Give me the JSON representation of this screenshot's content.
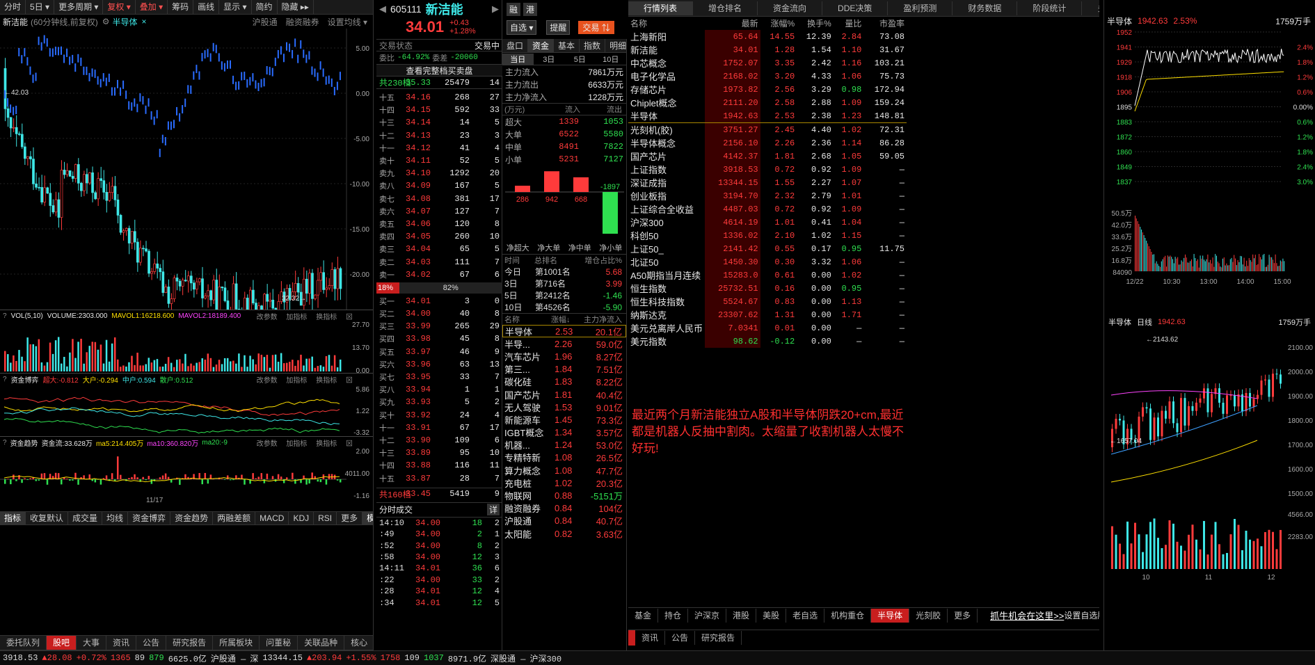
{
  "left": {
    "toolbar": [
      "分时",
      "5日 ▾",
      "更多周期 ▾",
      "复权 ▾",
      "叠加 ▾",
      "筹码",
      "画线",
      "显示 ▾",
      "简约",
      "隐藏 ▸▸"
    ],
    "title": "新洁能",
    "title_sub": "(60分钟线,前复权)",
    "overlay": "半导体",
    "top_links": [
      "沪股通",
      "融资融券",
      "设置均线 ▾"
    ],
    "axis": [
      "5.00",
      "0.00",
      "-5.00",
      "-10.00",
      "-15.00",
      "-20.00"
    ],
    "hi": "42.03",
    "lo": "32.32",
    "vol": {
      "label": "VOL(5,10)",
      "v1": "VOLUME:2303.000",
      "v2": "MAVOL1:16218.600",
      "v3": "MAVOL2:18189.400",
      "axis": [
        "27.70",
        "13.70",
        "0.00"
      ]
    },
    "zjbk": {
      "label": "资金博弈",
      "big": "超大:-0.812",
      "dh": "大户:-0.294",
      "zh": "中户:0.594",
      "sh": "散户:0.512",
      "axis": [
        "5.86",
        "1.22",
        "-3.32"
      ]
    },
    "zjqs": {
      "label": "资金趋势",
      "flow": "资金流:33.628万",
      "ma5": "ma5:214.405万",
      "ma10": "ma10:360.820万",
      "ma20": "ma20:-9",
      "axis": [
        "2.00",
        "4011.00",
        "-1.16"
      ]
    },
    "tools": [
      "改参数",
      "加指标",
      "换指标"
    ],
    "date": "11/17",
    "ind_tabs": [
      "指标",
      "收复默认",
      "成交量",
      "均线",
      "资金博弈",
      "资金趋势",
      "两融差额",
      "MACD",
      "KDJ",
      "RSI",
      "更多",
      "模板"
    ],
    "bot_tabs": [
      "委托队列",
      "股吧",
      "大事",
      "资讯",
      "公告",
      "研究报告",
      "所属板块",
      "问董秘",
      "关联品种",
      "核心"
    ]
  },
  "quote": {
    "code": "605111",
    "name": "新洁能",
    "price": "34.01",
    "chg": "+0.43",
    "pct": "+1.28%",
    "btn1": "融",
    "btn2": "港",
    "self": "自选 ▾",
    "remind": "提醒",
    "trade": "交易 ⇅",
    "status": "交易状态",
    "status_v": "交易中",
    "wb": "委比",
    "wb_v": "-64.92%",
    "wc": "委差",
    "wc_v": "-20060",
    "all": "查看完整档买卖盘",
    "total_ask": "共230档",
    "total_ask_p": "35.33",
    "total_ask_v": "25479",
    "total_ask_n": "14",
    "asks": [
      [
        "十五",
        "34.16",
        "268",
        "27"
      ],
      [
        "十四",
        "34.15",
        "592",
        "33"
      ],
      [
        "十三",
        "34.14",
        "14",
        "5"
      ],
      [
        "十二",
        "34.13",
        "23",
        "3"
      ],
      [
        "十一",
        "34.12",
        "41",
        "4"
      ],
      [
        "卖十",
        "34.11",
        "52",
        "5"
      ],
      [
        "卖九",
        "34.10",
        "1292",
        "20"
      ],
      [
        "卖八",
        "34.09",
        "167",
        "5"
      ],
      [
        "卖七",
        "34.08",
        "381",
        "17"
      ],
      [
        "卖六",
        "34.07",
        "127",
        "7"
      ],
      [
        "卖五",
        "34.06",
        "120",
        "8"
      ],
      [
        "卖四",
        "34.05",
        "260",
        "10"
      ],
      [
        "卖三",
        "34.04",
        "65",
        "5"
      ],
      [
        "卖二",
        "34.03",
        "111",
        "7"
      ],
      [
        "卖一",
        "34.02",
        "67",
        "6"
      ]
    ],
    "ratio_l": "18%",
    "ratio_r": "82%",
    "bids": [
      [
        "买一",
        "34.01",
        "3",
        "0"
      ],
      [
        "买二",
        "34.00",
        "40",
        "8"
      ],
      [
        "买三",
        "33.99",
        "265",
        "29"
      ],
      [
        "买四",
        "33.98",
        "45",
        "8"
      ],
      [
        "买五",
        "33.97",
        "46",
        "9"
      ],
      [
        "买六",
        "33.96",
        "63",
        "13"
      ],
      [
        "买七",
        "33.95",
        "33",
        "7"
      ],
      [
        "买八",
        "33.94",
        "1",
        "1"
      ],
      [
        "买九",
        "33.93",
        "5",
        "2"
      ],
      [
        "买十",
        "33.92",
        "24",
        "4"
      ],
      [
        "十一",
        "33.91",
        "67",
        "17"
      ],
      [
        "十二",
        "33.90",
        "109",
        "6"
      ],
      [
        "十三",
        "33.89",
        "95",
        "10"
      ],
      [
        "十四",
        "33.88",
        "116",
        "11"
      ],
      [
        "十五",
        "33.87",
        "28",
        "7"
      ]
    ],
    "total_bid": "共160档",
    "total_bid_p": "33.45",
    "total_bid_v": "5419",
    "total_bid_n": "9",
    "ticks_title": "分时成交",
    "ticks_more": "详",
    "ticks": [
      [
        "14:10",
        "34.00",
        "18",
        "2"
      ],
      [
        ":49",
        "34.00",
        "2",
        "1"
      ],
      [
        ":52",
        "34.00",
        "8",
        "2"
      ],
      [
        ":58",
        "34.00",
        "12",
        "3"
      ],
      [
        "14:11",
        "34.01",
        "36",
        "6"
      ],
      [
        ":22",
        "34.00",
        "33",
        "2"
      ],
      [
        ":28",
        "34.01",
        "12",
        "4"
      ],
      [
        ":34",
        "34.01",
        "12",
        "5"
      ]
    ]
  },
  "fund": {
    "tabs": [
      "盘口",
      "资金",
      "基本",
      "指数",
      "明细",
      "逐笔"
    ],
    "days": [
      "当日",
      "3日",
      "5日",
      "10日"
    ],
    "flows": [
      [
        "主力流入",
        "7861万元"
      ],
      [
        "主力流出",
        "6633万元"
      ],
      [
        "主力净流入",
        "1228万元"
      ]
    ],
    "hdr": [
      "(万元)",
      "流入",
      "流出"
    ],
    "rows": [
      [
        "超大",
        "1339",
        "1053"
      ],
      [
        "大单",
        "6522",
        "5580"
      ],
      [
        "中单",
        "8491",
        "7822"
      ],
      [
        "小单",
        "5231",
        "7127"
      ]
    ],
    "bars": [
      {
        "v": 286,
        "l": "286"
      },
      {
        "v": 942,
        "l": "942"
      },
      {
        "v": 668,
        "l": "668"
      },
      {
        "v": -1897,
        "l": "-1897"
      }
    ],
    "bar_lbls": [
      "净超大",
      "净大单",
      "净中单",
      "净小单"
    ],
    "rank_hdr": [
      "时间",
      "总排名",
      "增仓占比%"
    ],
    "ranks": [
      [
        "今日",
        "第1001名",
        "5.68"
      ],
      [
        "3日",
        "第716名",
        "3.99"
      ],
      [
        "5日",
        "第2412名",
        "-1.46"
      ],
      [
        "10日",
        "第4526名",
        "-5.90"
      ]
    ],
    "sect_hdr": [
      "名称",
      "涨幅↓",
      "主力净流入"
    ],
    "sects": [
      [
        "半导体",
        "2.53",
        "20.1亿"
      ],
      [
        "半导...",
        "2.26",
        "59.0亿"
      ],
      [
        "汽车芯片",
        "1.96",
        "8.27亿"
      ],
      [
        "第三...",
        "1.84",
        "7.51亿"
      ],
      [
        "碳化硅",
        "1.83",
        "8.22亿"
      ],
      [
        "国产芯片",
        "1.81",
        "40.4亿"
      ],
      [
        "无人驾驶",
        "1.53",
        "9.01亿"
      ],
      [
        "新能源车",
        "1.45",
        "73.3亿"
      ],
      [
        "IGBT概念",
        "1.34",
        "3.57亿"
      ],
      [
        "机器...",
        "1.24",
        "53.0亿"
      ],
      [
        "专精特新",
        "1.08",
        "26.5亿"
      ],
      [
        "算力概念",
        "1.08",
        "47.7亿"
      ],
      [
        "充电桩",
        "1.02",
        "20.3亿"
      ],
      [
        "物联网",
        "0.88",
        "-5151万"
      ],
      [
        "融资融券",
        "0.84",
        "104亿"
      ],
      [
        "沪股通",
        "0.84",
        "40.7亿"
      ],
      [
        "太阳能",
        "0.82",
        "3.63亿"
      ]
    ]
  },
  "mkt": {
    "tabs": [
      "行情列表",
      "增仓排名",
      "资金流向",
      "DDE决策",
      "盈利预测",
      "财务数据",
      "阶段统计",
      "多股同列"
    ],
    "hdr": [
      "名称",
      "最新",
      "涨幅%",
      "换手%",
      "量比",
      "市盈率"
    ],
    "rows": [
      [
        "上海新阳",
        "65.64",
        "14.55",
        "12.39",
        "2.84",
        "73.08"
      ],
      [
        "新洁能",
        "34.01",
        "1.28",
        "1.54",
        "1.10",
        "31.67"
      ],
      [
        "中芯概念",
        "1752.07",
        "3.35",
        "2.42",
        "1.16",
        "103.21"
      ],
      [
        "电子化学品",
        "2168.02",
        "3.20",
        "4.33",
        "1.06",
        "75.73"
      ],
      [
        "存储芯片",
        "1973.82",
        "2.56",
        "3.29",
        "0.98",
        "172.94"
      ],
      [
        "Chiplet概念",
        "2111.20",
        "2.58",
        "2.88",
        "1.09",
        "159.24"
      ],
      [
        "半导体",
        "1942.63",
        "2.53",
        "2.38",
        "1.23",
        "148.81"
      ],
      [
        "光刻机(胶)",
        "3751.27",
        "2.45",
        "4.40",
        "1.02",
        "72.31"
      ],
      [
        "半导体概念",
        "2156.10",
        "2.26",
        "2.36",
        "1.14",
        "86.28"
      ],
      [
        "国产芯片",
        "4142.37",
        "1.81",
        "2.68",
        "1.05",
        "59.05"
      ],
      [
        "上证指数",
        "3918.53",
        "0.72",
        "0.92",
        "1.09",
        "—"
      ],
      [
        "深证成指",
        "13344.15",
        "1.55",
        "2.27",
        "1.07",
        "—"
      ],
      [
        "创业板指",
        "3194.70",
        "2.32",
        "2.79",
        "1.01",
        "—"
      ],
      [
        "上证综合全收益",
        "4487.03",
        "0.72",
        "0.92",
        "1.09",
        "—"
      ],
      [
        "沪深300",
        "4614.19",
        "1.01",
        "0.41",
        "1.04",
        "—"
      ],
      [
        "科创50",
        "1336.02",
        "2.10",
        "1.02",
        "1.15",
        "—"
      ],
      [
        "上证50_",
        "2141.42",
        "0.55",
        "0.17",
        "0.95",
        "11.75"
      ],
      [
        "北证50",
        "1450.30",
        "0.30",
        "3.32",
        "1.06",
        "—"
      ],
      [
        "A50期指当月连续",
        "15283.0",
        "0.61",
        "0.00",
        "1.02",
        "—"
      ],
      [
        "恒生指数",
        "25732.51",
        "0.16",
        "0.00",
        "0.95",
        "—"
      ],
      [
        "恒生科技指数",
        "5524.67",
        "0.83",
        "0.00",
        "1.13",
        "—"
      ],
      [
        "纳斯达克",
        "23307.62",
        "1.31",
        "0.00",
        "1.71",
        "—"
      ],
      [
        "美元兑离岸人民币",
        "7.0341",
        "0.01",
        "0.00",
        "—",
        "—"
      ],
      [
        "美元指数",
        "98.62",
        "-0.12",
        "0.00",
        "—",
        "—"
      ]
    ],
    "note": "最近两个月新洁能独立A股和半导体阴跌20+cm,最近都是机器人反抽中割肉。太缩量了收割机器人太慢不好玩!",
    "bot_tabs": [
      "基金",
      "持仓",
      "沪深京",
      "港股",
      "美股",
      "老自选",
      "机构重仓",
      "半导体",
      "光刻胶",
      "更多"
    ],
    "promo": "抓牛机会在这里>>",
    "settings": "设置自选股",
    "bot2": [
      "资讯",
      "公告",
      "研究报告"
    ]
  },
  "mini": {
    "name": "半导体",
    "price": "1942.63",
    "pct": "2.53%",
    "vol": "1759万手",
    "axis_l": [
      "1952",
      "1941",
      "1929",
      "1918",
      "1906",
      "1895",
      "1883",
      "1872",
      "1860",
      "1849",
      "1837"
    ],
    "axis_r": [
      "2.4%",
      "1.8%",
      "1.2%",
      "0.6%",
      "0.00%",
      "0.6%",
      "1.2%",
      "1.8%",
      "2.4%",
      "3.0%"
    ],
    "vol_axis": [
      "50.5万",
      "42.0万",
      "33.6万",
      "25.2万",
      "16.8万",
      "84090"
    ],
    "times": [
      "12/22",
      "10:30",
      "13:00",
      "14:00",
      "15:00"
    ],
    "k_name": "半导体",
    "k_type": "日线",
    "k_price": "1942.63",
    "k_vol": "1759万手",
    "k_hi": "2143.62",
    "k_lo": "1657.04",
    "k_axis": [
      "2100.00",
      "2000.00",
      "1900.00",
      "1800.00",
      "1700.00",
      "1600.00",
      "1500.00"
    ],
    "kv_axis": [
      "4566.00",
      "2283.00"
    ],
    "k_dates": [
      "10",
      "11",
      "12"
    ]
  },
  "status": {
    "items": [
      "3918.53",
      "▲28.08",
      "+0.72%",
      "1365",
      "89",
      "879",
      "6625.0亿",
      "沪股通 —",
      "深",
      "13344.15",
      "▲203.94",
      "+1.55%",
      "1758",
      "109",
      "1037",
      "8971.9亿",
      "深股通 —",
      "沪深300"
    ],
    "right": [
      ".72%",
      "1365",
      "89",
      "879",
      "6625.0亿",
      "沪股通 —",
      "深",
      "13344.15",
      "▲203.94",
      "+1.55%",
      "1758",
      "109",
      "1037",
      "8971.9亿",
      "深股通 —"
    ]
  },
  "colors": {
    "up": "#ff3b3b",
    "down": "#2fe050",
    "accent": "#c81e1e",
    "line": "#ffe000"
  }
}
